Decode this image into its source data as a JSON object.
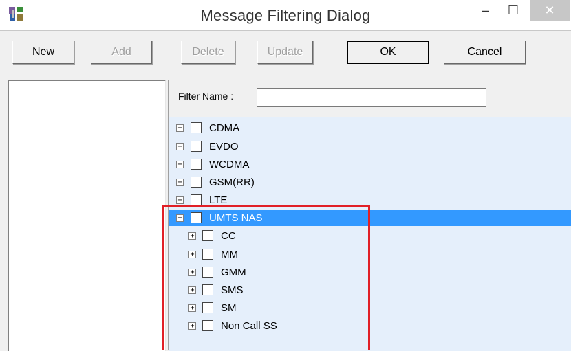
{
  "window": {
    "title": "Message Filtering Dialog",
    "minimize_glyph": "–",
    "maximize_glyph": "☐",
    "close_glyph": "✕"
  },
  "toolbar": {
    "new_label": "New",
    "add_label": "Add",
    "delete_label": "Delete",
    "update_label": "Update",
    "ok_label": "OK",
    "cancel_label": "Cancel"
  },
  "filter": {
    "label": "Filter Name :",
    "value": ""
  },
  "tree": {
    "items": [
      {
        "label": "CDMA",
        "expander": "+"
      },
      {
        "label": "EVDO",
        "expander": "+"
      },
      {
        "label": "WCDMA",
        "expander": "+"
      },
      {
        "label": "GSM(RR)",
        "expander": "+"
      },
      {
        "label": "LTE",
        "expander": "+"
      },
      {
        "label": "UMTS NAS",
        "expander": "−",
        "selected": true
      },
      {
        "label": "CC",
        "expander": "+"
      },
      {
        "label": "MM",
        "expander": "+"
      },
      {
        "label": "GMM",
        "expander": "+"
      },
      {
        "label": "SMS",
        "expander": "+"
      },
      {
        "label": "SM",
        "expander": "+"
      },
      {
        "label": "Non Call SS",
        "expander": "+"
      }
    ]
  },
  "colors": {
    "selection": "#3399ff",
    "tree_background": "#e5effb",
    "annotation": "#e11f26"
  }
}
